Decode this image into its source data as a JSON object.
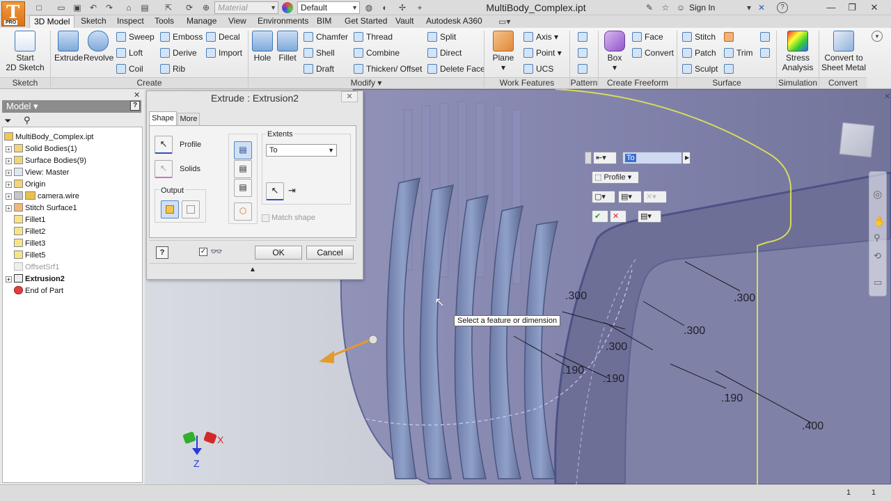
{
  "app": {
    "logo_text": "T",
    "edition": "PRO",
    "document_title": "MultiBody_Complex.ipt"
  },
  "quick_access": {
    "material_placeholder": "Material",
    "appearance_value": "Default"
  },
  "account": {
    "sign_in": "Sign In"
  },
  "tabs": [
    "3D Model",
    "Sketch",
    "Inspect",
    "Tools",
    "Manage",
    "View",
    "Environments",
    "BIM",
    "Get Started",
    "Vault",
    "Autodesk A360"
  ],
  "ribbon": {
    "sketch": {
      "start": "Start",
      "sketch2d": "2D Sketch",
      "panel": "Sketch"
    },
    "create": {
      "extrude": "Extrude",
      "revolve": "Revolve",
      "sweep": "Sweep",
      "emboss": "Emboss",
      "decal": "Decal",
      "loft": "Loft",
      "derive": "Derive",
      "import": "Import",
      "coil": "Coil",
      "rib": "Rib",
      "panel": "Create"
    },
    "modify": {
      "hole": "Hole",
      "fillet": "Fillet",
      "chamfer": "Chamfer",
      "thread": "Thread",
      "split": "Split",
      "shell": "Shell",
      "combine": "Combine",
      "direct": "Direct",
      "draft": "Draft",
      "thicken": "Thicken/ Offset",
      "delete_face": "Delete Face",
      "panel": "Modify"
    },
    "work": {
      "plane": "Plane",
      "axis": "Axis",
      "point": "Point",
      "ucs": "UCS",
      "panel": "Work Features"
    },
    "pattern": {
      "panel": "Pattern"
    },
    "freeform": {
      "box": "Box",
      "face": "Face",
      "convert": "Convert",
      "panel": "Create Freeform"
    },
    "surface": {
      "stitch": "Stitch",
      "patch": "Patch",
      "trim": "Trim",
      "sculpt": "Sculpt",
      "panel": "Surface"
    },
    "simulation": {
      "stress1": "Stress",
      "stress2": "Analysis",
      "panel": "Simulation"
    },
    "convert": {
      "c1": "Convert to",
      "c2": "Sheet Metal",
      "panel": "Convert"
    }
  },
  "browser": {
    "title": "Model",
    "help": "?",
    "nodes": [
      "MultiBody_Complex.ipt",
      "Solid Bodies(1)",
      "Surface Bodies(9)",
      "View: Master",
      "Origin",
      "camera.wire",
      "Stitch Surface1",
      "Fillet1",
      "Fillet2",
      "Fillet3",
      "Fillet5",
      "OffsetSrf1",
      "Extrusion2",
      "End of Part"
    ]
  },
  "dialog": {
    "title": "Extrude : Extrusion2",
    "tab_shape": "Shape",
    "tab_more": "More",
    "profile": "Profile",
    "solids": "Solids",
    "output": "Output",
    "extents": "Extents",
    "extents_value": "To",
    "match_shape": "Match shape",
    "ok": "OK",
    "cancel": "Cancel",
    "help": "?"
  },
  "minitoolbar": {
    "extent": "To",
    "profile": "Profile"
  },
  "tooltip": "Select a feature or dimension",
  "dimensions": [
    ".300",
    ".300",
    ".300",
    ".300",
    ".190",
    ".190",
    ".190",
    ".400"
  ],
  "triad": {
    "x": "X",
    "z": "Z"
  },
  "status": {
    "count1": "1",
    "count2": "1"
  }
}
